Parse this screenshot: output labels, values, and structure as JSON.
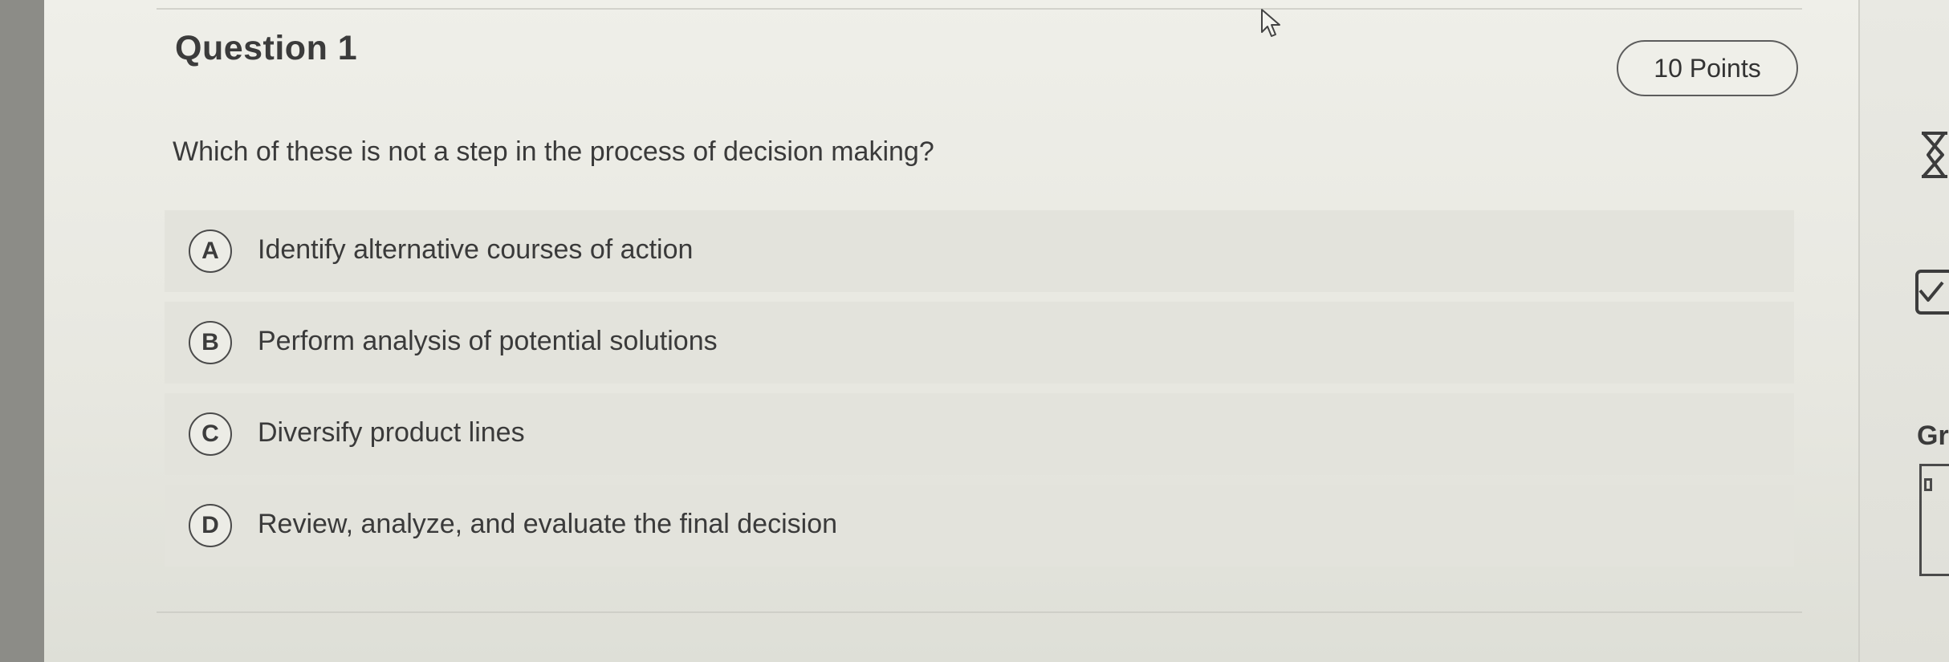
{
  "question": {
    "title": "Question 1",
    "points": "10 Points",
    "prompt": "Which of these is not a step in the process of decision making?",
    "options": [
      {
        "letter": "A",
        "text": "Identify alternative courses of action"
      },
      {
        "letter": "B",
        "text": "Perform analysis of potential solutions"
      },
      {
        "letter": "C",
        "text": "Diversify product lines"
      },
      {
        "letter": "D",
        "text": "Review, analyze, and evaluate the final decision"
      }
    ]
  },
  "side_rail": {
    "partial_label": "Gr",
    "icons": [
      "hourglass-icon",
      "checklist-icon"
    ]
  },
  "colors": {
    "background": "#e9e9e3",
    "option_background": "#e3e3dc",
    "text": "#3a3a3a",
    "outline": "#4a4a4a"
  }
}
